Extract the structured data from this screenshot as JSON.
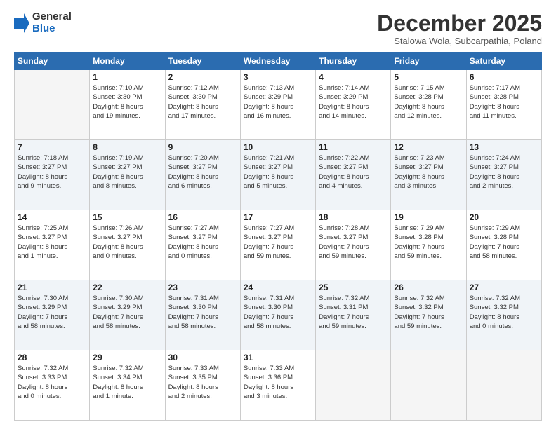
{
  "logo": {
    "general": "General",
    "blue": "Blue"
  },
  "header": {
    "month": "December 2025",
    "location": "Stalowa Wola, Subcarpathia, Poland"
  },
  "weekdays": [
    "Sunday",
    "Monday",
    "Tuesday",
    "Wednesday",
    "Thursday",
    "Friday",
    "Saturday"
  ],
  "weeks": [
    [
      {
        "day": "",
        "info": ""
      },
      {
        "day": "1",
        "info": "Sunrise: 7:10 AM\nSunset: 3:30 PM\nDaylight: 8 hours\nand 19 minutes."
      },
      {
        "day": "2",
        "info": "Sunrise: 7:12 AM\nSunset: 3:30 PM\nDaylight: 8 hours\nand 17 minutes."
      },
      {
        "day": "3",
        "info": "Sunrise: 7:13 AM\nSunset: 3:29 PM\nDaylight: 8 hours\nand 16 minutes."
      },
      {
        "day": "4",
        "info": "Sunrise: 7:14 AM\nSunset: 3:29 PM\nDaylight: 8 hours\nand 14 minutes."
      },
      {
        "day": "5",
        "info": "Sunrise: 7:15 AM\nSunset: 3:28 PM\nDaylight: 8 hours\nand 12 minutes."
      },
      {
        "day": "6",
        "info": "Sunrise: 7:17 AM\nSunset: 3:28 PM\nDaylight: 8 hours\nand 11 minutes."
      }
    ],
    [
      {
        "day": "7",
        "info": "Sunrise: 7:18 AM\nSunset: 3:27 PM\nDaylight: 8 hours\nand 9 minutes."
      },
      {
        "day": "8",
        "info": "Sunrise: 7:19 AM\nSunset: 3:27 PM\nDaylight: 8 hours\nand 8 minutes."
      },
      {
        "day": "9",
        "info": "Sunrise: 7:20 AM\nSunset: 3:27 PM\nDaylight: 8 hours\nand 6 minutes."
      },
      {
        "day": "10",
        "info": "Sunrise: 7:21 AM\nSunset: 3:27 PM\nDaylight: 8 hours\nand 5 minutes."
      },
      {
        "day": "11",
        "info": "Sunrise: 7:22 AM\nSunset: 3:27 PM\nDaylight: 8 hours\nand 4 minutes."
      },
      {
        "day": "12",
        "info": "Sunrise: 7:23 AM\nSunset: 3:27 PM\nDaylight: 8 hours\nand 3 minutes."
      },
      {
        "day": "13",
        "info": "Sunrise: 7:24 AM\nSunset: 3:27 PM\nDaylight: 8 hours\nand 2 minutes."
      }
    ],
    [
      {
        "day": "14",
        "info": "Sunrise: 7:25 AM\nSunset: 3:27 PM\nDaylight: 8 hours\nand 1 minute."
      },
      {
        "day": "15",
        "info": "Sunrise: 7:26 AM\nSunset: 3:27 PM\nDaylight: 8 hours\nand 0 minutes."
      },
      {
        "day": "16",
        "info": "Sunrise: 7:27 AM\nSunset: 3:27 PM\nDaylight: 8 hours\nand 0 minutes."
      },
      {
        "day": "17",
        "info": "Sunrise: 7:27 AM\nSunset: 3:27 PM\nDaylight: 7 hours\nand 59 minutes."
      },
      {
        "day": "18",
        "info": "Sunrise: 7:28 AM\nSunset: 3:27 PM\nDaylight: 7 hours\nand 59 minutes."
      },
      {
        "day": "19",
        "info": "Sunrise: 7:29 AM\nSunset: 3:28 PM\nDaylight: 7 hours\nand 59 minutes."
      },
      {
        "day": "20",
        "info": "Sunrise: 7:29 AM\nSunset: 3:28 PM\nDaylight: 7 hours\nand 58 minutes."
      }
    ],
    [
      {
        "day": "21",
        "info": "Sunrise: 7:30 AM\nSunset: 3:29 PM\nDaylight: 7 hours\nand 58 minutes."
      },
      {
        "day": "22",
        "info": "Sunrise: 7:30 AM\nSunset: 3:29 PM\nDaylight: 7 hours\nand 58 minutes."
      },
      {
        "day": "23",
        "info": "Sunrise: 7:31 AM\nSunset: 3:30 PM\nDaylight: 7 hours\nand 58 minutes."
      },
      {
        "day": "24",
        "info": "Sunrise: 7:31 AM\nSunset: 3:30 PM\nDaylight: 7 hours\nand 58 minutes."
      },
      {
        "day": "25",
        "info": "Sunrise: 7:32 AM\nSunset: 3:31 PM\nDaylight: 7 hours\nand 59 minutes."
      },
      {
        "day": "26",
        "info": "Sunrise: 7:32 AM\nSunset: 3:32 PM\nDaylight: 7 hours\nand 59 minutes."
      },
      {
        "day": "27",
        "info": "Sunrise: 7:32 AM\nSunset: 3:32 PM\nDaylight: 8 hours\nand 0 minutes."
      }
    ],
    [
      {
        "day": "28",
        "info": "Sunrise: 7:32 AM\nSunset: 3:33 PM\nDaylight: 8 hours\nand 0 minutes."
      },
      {
        "day": "29",
        "info": "Sunrise: 7:32 AM\nSunset: 3:34 PM\nDaylight: 8 hours\nand 1 minute."
      },
      {
        "day": "30",
        "info": "Sunrise: 7:33 AM\nSunset: 3:35 PM\nDaylight: 8 hours\nand 2 minutes."
      },
      {
        "day": "31",
        "info": "Sunrise: 7:33 AM\nSunset: 3:36 PM\nDaylight: 8 hours\nand 3 minutes."
      },
      {
        "day": "",
        "info": ""
      },
      {
        "day": "",
        "info": ""
      },
      {
        "day": "",
        "info": ""
      }
    ]
  ]
}
